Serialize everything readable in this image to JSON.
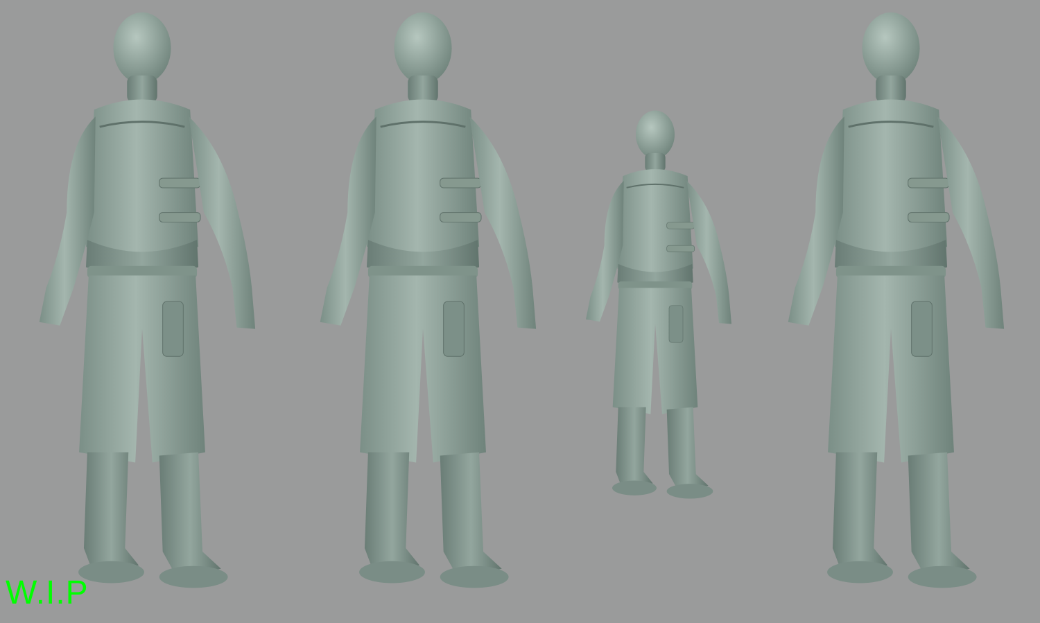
{
  "render": {
    "background": "#9a9b9b",
    "clay_color": "#8ea39a",
    "clay_shadow": "#6f837b",
    "clay_highlight": "#b7c8c0",
    "views": [
      "front-three-quarter",
      "front",
      "side",
      "back-three-quarter"
    ]
  },
  "overlay": {
    "label": "W.I.P",
    "label_color": "#00ff00"
  }
}
